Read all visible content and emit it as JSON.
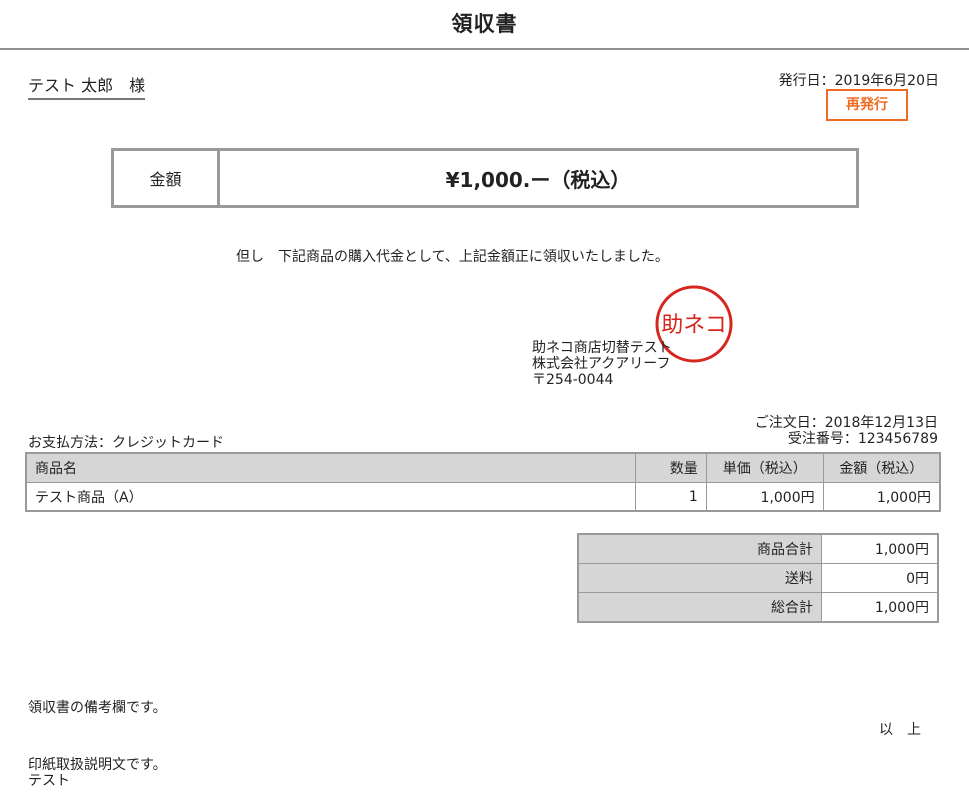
{
  "header": {
    "title": "領収書"
  },
  "recipient": {
    "name": "テスト 太郎　様"
  },
  "issue": {
    "label": "発行日：",
    "date": "2019年6月20日",
    "reissue_label": "再発行"
  },
  "amount": {
    "label": "金額",
    "value": "¥1,000.ー（税込）"
  },
  "proviso": "但し　下記商品の購入代金として、上記金額正に領収いたしました。",
  "stamp": {
    "text": "助ネコ",
    "color": "#d7261e"
  },
  "issuer": {
    "shop": "助ネコ商店切替テスト",
    "company": "株式会社アクアリーフ",
    "postal": "〒254-0044"
  },
  "payment": {
    "label": "お支払方法：",
    "value": "クレジットカード"
  },
  "order": {
    "date_label": "ご注文日：",
    "date": "2018年12月13日",
    "number_label": "受注番号：",
    "number": "123456789"
  },
  "items_table": {
    "headers": {
      "name": "商品名",
      "qty": "数量",
      "price": "単価（税込）",
      "amount": "金額（税込）"
    },
    "rows": [
      {
        "name": "テスト商品（A）",
        "qty": "1",
        "price": "1,000円",
        "amount": "1,000円"
      }
    ]
  },
  "totals": [
    {
      "label": "商品合計",
      "value": "1,000円"
    },
    {
      "label": "送料",
      "value": "0円"
    },
    {
      "label": "総合計",
      "value": "1,000円"
    }
  ],
  "remarks": "領収書の備考欄です。",
  "closing": "以　上",
  "stamp_note": {
    "line1": "印紙取扱説明文です。",
    "line2": "テスト"
  },
  "colors": {
    "accent": "#ef6b22",
    "border": "#9a9a9a",
    "header_bg": "#d6d6d6"
  }
}
